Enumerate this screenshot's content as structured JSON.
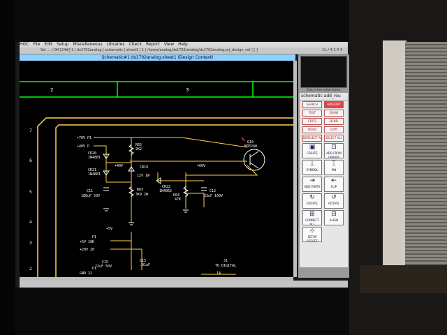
{
  "menubar": {
    "items": [
      "HGC",
      "File",
      "Edit",
      "Setup",
      "Miscellaneous",
      "Libraries",
      "Check",
      "Report",
      "View",
      "Help"
    ]
  },
  "toolbar": {
    "text": "Sel … | Off [24#] 1 | ds1702analog | schematic | sheet1 | 1 | /home/analog/ds1702/analog/ds1702analog.prj_design_vel | [ ]",
    "coords": "Cs / 4 1 4 3"
  },
  "document": {
    "title": "Schematic#1 ds1702analog.sheet1 (Design Context)"
  },
  "schematic": {
    "zones": [
      "2",
      "3"
    ],
    "rows": [
      "7",
      "6",
      "5",
      "4",
      "3",
      "2"
    ],
    "colors": {
      "border": "#00ff00",
      "wire": "#ffd24a",
      "part": "#ffffff",
      "selected": "#ff3030"
    },
    "labels": {
      "p70": "+70V  P1",
      "p40": "+40V  P",
      "cr20": "CR20",
      "cr20v": "1N4881",
      "cr21": "CR21",
      "cr21v": "1N4881",
      "c11": "C11",
      "c11v": "180uF 50V",
      "r65": "R65",
      "r65v": "2K2",
      "plus40": "+40V",
      "cr19": "CR19",
      "cr19v": "12V 1W",
      "r63": "R63",
      "r63v": "3K9 2W",
      "plus60": "+60V",
      "cr22": "CR22",
      "cr22v": "1N4862",
      "r64": "R64",
      "r64v": "47K",
      "c12": "C12",
      "c12v": "33uF 100V",
      "q10": "Q10",
      "q10v": "MJE240",
      "plus5": "+5V",
      "p1a": "P1",
      "p5v": "+5V  10K",
      "p20": "+20V  20",
      "c15": "C15",
      "c15v": "22uF 50V",
      "c13": "C13",
      "c13v": ".01uF",
      "p1b": "P1",
      "gnd": "GND  22",
      "j1": "J1",
      "j1v": "TO DIGITAL",
      "pin14": "14"
    }
  },
  "side": {
    "caption": "Click in the active frame",
    "panel_title": "schematic  add_rou",
    "buttons": [
      [
        "SEARCH",
        "ADD/EDIT"
      ],
      [
        "TEXT",
        "DRAW"
      ],
      [
        "EDITS",
        "BEND"
      ],
      [
        "MOVE",
        "COPY"
      ],
      [
        "DESELECT ALL",
        "SELECT ALL"
      ]
    ],
    "tools": [
      [
        {
          "icon": "▣",
          "label": "CREATE"
        },
        {
          "icon": "⊡",
          "label": "ADD FROM LIBRARY"
        }
      ],
      [
        {
          "icon": "⊥",
          "label": "SYMBOL"
        },
        {
          "icon": "⌶",
          "label": "PIN"
        }
      ],
      [
        {
          "icon": "⇥",
          "label": "ADD PORTS"
        },
        {
          "icon": "⇤",
          "label": "FLIP"
        }
      ],
      [
        {
          "icon": "↻",
          "label": "ROTATE"
        },
        {
          "icon": "↺",
          "label": "ROTATE"
        }
      ],
      [
        {
          "icon": "⊞",
          "label": "CONNECT ALL"
        },
        {
          "icon": "⊟",
          "label": "ALIGN"
        }
      ],
      [
        {
          "icon": "⊹",
          "label": "SETUP OFFSET"
        }
      ]
    ]
  }
}
